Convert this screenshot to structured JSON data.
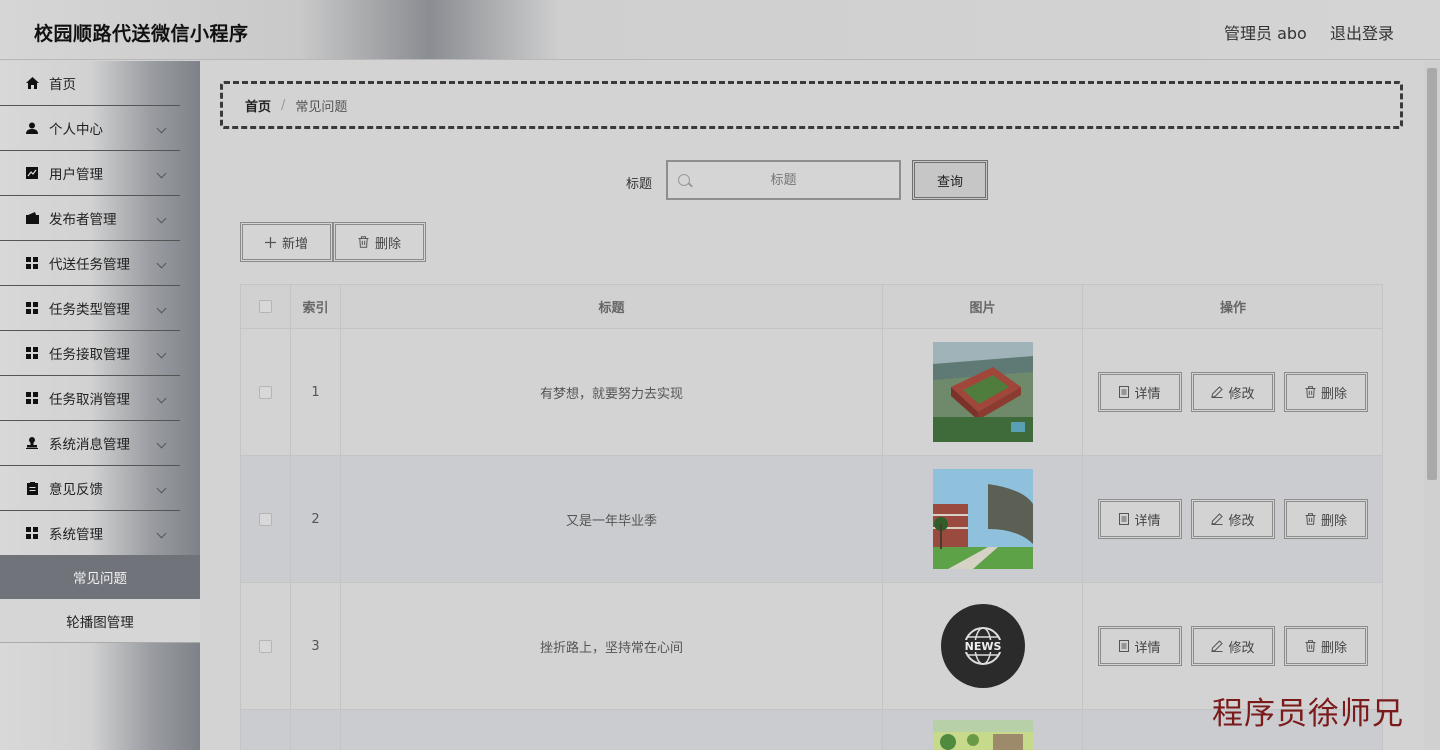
{
  "header": {
    "app_title": "校园顺路代送微信小程序",
    "admin": "管理员 abo",
    "logout": "退出登录"
  },
  "sidebar": {
    "items": [
      {
        "label": "首页",
        "icon": "home-icon"
      },
      {
        "label": "个人中心",
        "icon": "user-icon"
      },
      {
        "label": "用户管理",
        "icon": "chart-icon"
      },
      {
        "label": "发布者管理",
        "icon": "wallet-icon"
      },
      {
        "label": "代送任务管理",
        "icon": "grid-icon"
      },
      {
        "label": "任务类型管理",
        "icon": "grid-icon"
      },
      {
        "label": "任务接取管理",
        "icon": "grid-icon"
      },
      {
        "label": "任务取消管理",
        "icon": "grid-icon"
      },
      {
        "label": "系统消息管理",
        "icon": "stamp-icon"
      },
      {
        "label": "意见反馈",
        "icon": "clipboard-icon"
      },
      {
        "label": "系统管理",
        "icon": "grid-icon"
      }
    ],
    "sub_items": [
      {
        "label": "常见问题",
        "active": true
      },
      {
        "label": "轮播图管理",
        "active": false
      }
    ]
  },
  "breadcrumb": {
    "home": "首页",
    "separator": "/",
    "current": "常见问题"
  },
  "search": {
    "label": "标题",
    "placeholder": "标题",
    "query_button": "查询"
  },
  "actions": {
    "add": "新增",
    "delete": "删除"
  },
  "table": {
    "columns": [
      "索引",
      "标题",
      "图片",
      "操作"
    ],
    "rows": [
      {
        "index": "1",
        "title": "有梦想，就要努力去实现",
        "image": "campus-aerial"
      },
      {
        "index": "2",
        "title": "又是一年毕业季",
        "image": "campus-courtyard"
      },
      {
        "index": "3",
        "title": "挫折路上，坚持常在心间",
        "image": "news-globe"
      },
      {
        "index": "",
        "title": "",
        "image": "campus-trees"
      }
    ],
    "row_actions": {
      "detail": "详情",
      "edit": "修改",
      "delete": "删除"
    }
  },
  "watermark": "程序员徐师兄",
  "colors": {
    "header_text": "#111111",
    "active_sub_bg": "#70747a",
    "watermark": "#7a1a1a"
  }
}
